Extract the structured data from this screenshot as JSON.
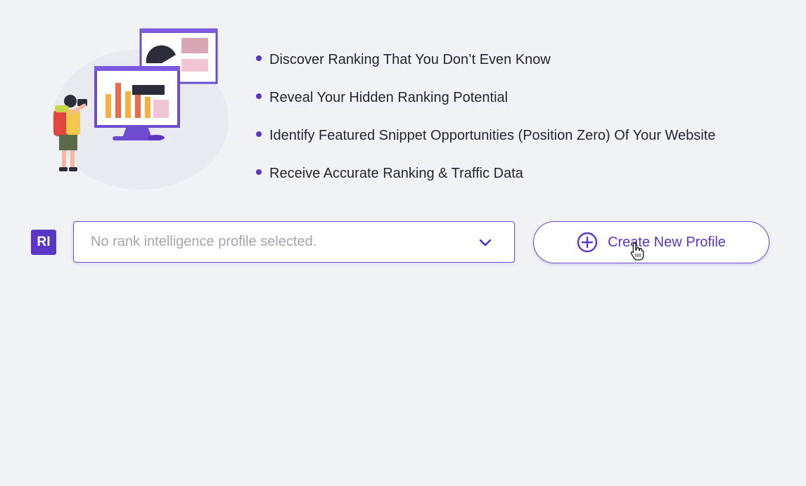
{
  "features": [
    {
      "text": "Discover Ranking That You Don’t Even Know"
    },
    {
      "text": "Reveal Your Hidden Ranking Potential"
    },
    {
      "text": "Identify Featured Snippet Opportunities (Position Zero) Of Your Website"
    },
    {
      "text": "Receive Accurate Ranking & Traffic Data"
    }
  ],
  "badge": {
    "label": "RI"
  },
  "profile_select": {
    "placeholder": "No rank intelligence profile selected."
  },
  "create_button": {
    "label": "Create New Profile"
  },
  "icons": {
    "illustration": "traveler-with-charts-illustration",
    "chevron": "chevron-down-icon",
    "plus": "plus-circle-icon",
    "cursor": "hand-pointer-cursor-icon"
  },
  "colors": {
    "accent": "#5a36c4",
    "background": "#f1f2f6",
    "placeholder_text": "#a3a6b0",
    "text": "#1f2433"
  }
}
